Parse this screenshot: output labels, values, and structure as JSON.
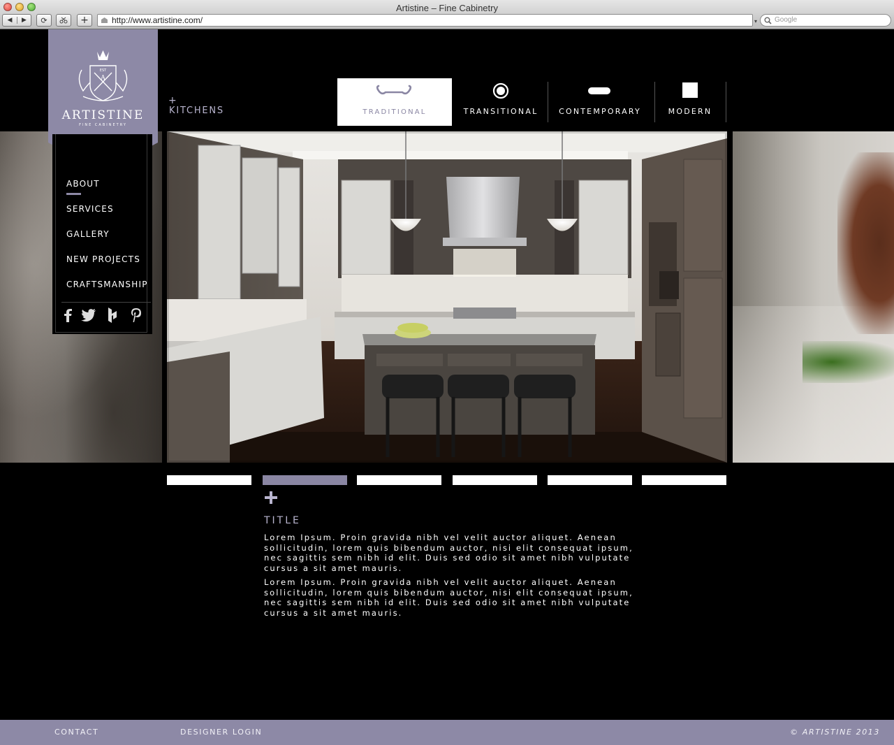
{
  "browser": {
    "window_title": "Artistine – Fine Cabinetry",
    "back_glyph": "◀",
    "forward_glyph": "▶",
    "reload_glyph": "⟳",
    "add_tab_glyph": "+",
    "url": "http://www.artistine.com/",
    "search_placeholder": "Google"
  },
  "brand": {
    "name": "ARTISTINE",
    "tagline": "FINE CABINETRY",
    "est": "EST",
    "monogram": "A",
    "banner_color": "#8d89a6"
  },
  "sidenav": {
    "items": [
      {
        "label": "ABOUT",
        "active": true
      },
      {
        "label": "SERVICES"
      },
      {
        "label": "GALLERY"
      },
      {
        "label": "NEW PROJECTS"
      },
      {
        "label": "CRAFTSMANSHIP"
      }
    ],
    "social": [
      "facebook-icon",
      "twitter-icon",
      "houzz-icon",
      "pinterest-icon"
    ]
  },
  "breadcrumb": {
    "plus": "+",
    "label": "KITCHENS"
  },
  "style_tabs": [
    {
      "label": "TRADITIONAL",
      "icon": "scroll-handle-icon",
      "active": true
    },
    {
      "label": "TRANSITIONAL",
      "icon": "ring-icon"
    },
    {
      "label": "CONTEMPORARY",
      "icon": "bar-handle-icon"
    },
    {
      "label": "MODERN",
      "icon": "square-icon"
    }
  ],
  "slideshow": {
    "count": 6,
    "active_index": 1
  },
  "content": {
    "title": "TITLE",
    "paragraphs": [
      "Lorem Ipsum. Proin gravida nibh vel velit auctor aliquet. Aenean sollicitudin, lorem quis bibendum auctor, nisi elit consequat ipsum, nec sagittis sem nibh id elit. Duis sed odio sit amet nibh vulputate cursus a sit amet mauris.",
      "Lorem Ipsum. Proin gravida nibh vel velit auctor aliquet. Aenean sollicitudin, lorem quis bibendum auctor, nisi elit consequat ipsum, nec sagittis sem nibh id elit. Duis sed odio sit amet nibh vulputate cursus a sit amet mauris."
    ]
  },
  "footer": {
    "contact": "CONTACT",
    "designer_login": "DESIGNER LOGIN",
    "copyright": "© ARTISTINE 2013"
  },
  "colors": {
    "accent": "#8d89a6",
    "accent_light": "#b9b5cf",
    "background": "#000000"
  }
}
